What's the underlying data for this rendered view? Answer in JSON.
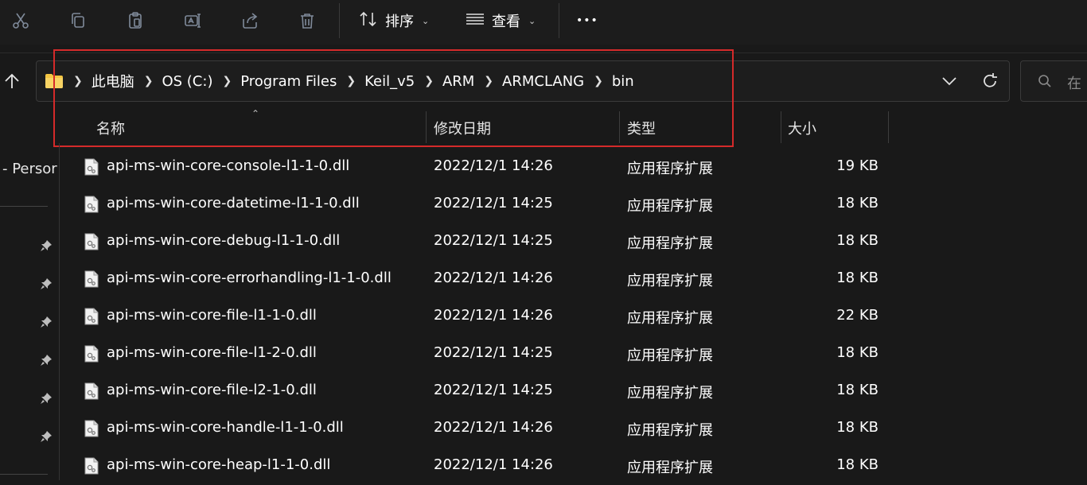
{
  "toolbar": {
    "icons": [
      "cut-icon",
      "copy-icon",
      "paste-icon",
      "rename-icon",
      "share-icon",
      "delete-icon"
    ],
    "sort_label": "排序",
    "view_label": "查看",
    "more_label": "•••"
  },
  "address": {
    "crumbs": [
      "此电脑",
      "OS (C:)",
      "Program Files",
      "Keil_v5",
      "ARM",
      "ARMCLANG",
      "bin"
    ]
  },
  "search": {
    "placeholder": "在"
  },
  "columns": {
    "name": "名称",
    "modified": "修改日期",
    "type": "类型",
    "size": "大小"
  },
  "nav": {
    "label": "- Persor"
  },
  "files": [
    {
      "name": "api-ms-win-core-console-l1-1-0.dll",
      "date": "2022/12/1 14:26",
      "type": "应用程序扩展",
      "size": "19 KB"
    },
    {
      "name": "api-ms-win-core-datetime-l1-1-0.dll",
      "date": "2022/12/1 14:25",
      "type": "应用程序扩展",
      "size": "18 KB"
    },
    {
      "name": "api-ms-win-core-debug-l1-1-0.dll",
      "date": "2022/12/1 14:25",
      "type": "应用程序扩展",
      "size": "18 KB"
    },
    {
      "name": "api-ms-win-core-errorhandling-l1-1-0.dll",
      "date": "2022/12/1 14:26",
      "type": "应用程序扩展",
      "size": "18 KB"
    },
    {
      "name": "api-ms-win-core-file-l1-1-0.dll",
      "date": "2022/12/1 14:26",
      "type": "应用程序扩展",
      "size": "22 KB"
    },
    {
      "name": "api-ms-win-core-file-l1-2-0.dll",
      "date": "2022/12/1 14:25",
      "type": "应用程序扩展",
      "size": "18 KB"
    },
    {
      "name": "api-ms-win-core-file-l2-1-0.dll",
      "date": "2022/12/1 14:25",
      "type": "应用程序扩展",
      "size": "18 KB"
    },
    {
      "name": "api-ms-win-core-handle-l1-1-0.dll",
      "date": "2022/12/1 14:26",
      "type": "应用程序扩展",
      "size": "18 KB"
    },
    {
      "name": "api-ms-win-core-heap-l1-1-0.dll",
      "date": "2022/12/1 14:26",
      "type": "应用程序扩展",
      "size": "18 KB"
    }
  ],
  "colors": {
    "background": "#191919",
    "highlight": "#d42a2a",
    "folder": "#f4c542"
  }
}
